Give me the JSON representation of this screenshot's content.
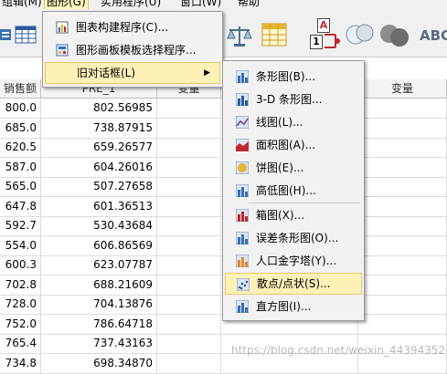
{
  "menubar": {
    "items": [
      {
        "label": "组辑(M)"
      },
      {
        "label": "图形(G)"
      },
      {
        "label": "实用程序(U)"
      },
      {
        "label": "窗口(W)"
      },
      {
        "label": "帮助"
      }
    ]
  },
  "toolbar": {
    "abc_label": "ABC",
    "a_label": "A",
    "one_label": "1"
  },
  "grid": {
    "headers": [
      "销售额",
      "PRE_1",
      "变量",
      "",
      "变量"
    ],
    "rows": [
      [
        "800.0",
        "802.56985"
      ],
      [
        "685.0",
        "738.87915"
      ],
      [
        "620.5",
        "659.26577"
      ],
      [
        "587.0",
        "604.26016"
      ],
      [
        "565.0",
        "507.27658"
      ],
      [
        "647.8",
        "601.36513"
      ],
      [
        "592.7",
        "530.43684"
      ],
      [
        "554.0",
        "606.86569"
      ],
      [
        "600.3",
        "623.07787"
      ],
      [
        "702.8",
        "688.21609"
      ],
      [
        "728.0",
        "704.13876"
      ],
      [
        "752.0",
        "786.64718"
      ],
      [
        "765.4",
        "737.43163"
      ],
      [
        "734.8",
        "698.34870"
      ]
    ]
  },
  "graph_menu": {
    "items": [
      {
        "label": "图表构建程序(C)...",
        "icon": "chart-builder-icon"
      },
      {
        "label": "图形画板模板选择程序...",
        "icon": "template-chooser-icon"
      },
      {
        "label": "旧对话框(L)",
        "icon": "",
        "submenu": true
      }
    ]
  },
  "legacy_menu": {
    "items": [
      {
        "label": "条形图(B)...",
        "icon": "bar-chart-icon"
      },
      {
        "label": "3-D 条形图...",
        "icon": "3d-bar-chart-icon"
      },
      {
        "label": "线图(L)...",
        "icon": "line-chart-icon"
      },
      {
        "label": "面积图(A)...",
        "icon": "area-chart-icon"
      },
      {
        "label": "饼图(E)...",
        "icon": "pie-chart-icon"
      },
      {
        "label": "高低图(H)...",
        "icon": "high-low-chart-icon"
      },
      {
        "label": "箱图(X)...",
        "icon": "boxplot-icon"
      },
      {
        "label": "误差条形图(O)...",
        "icon": "error-bar-icon"
      },
      {
        "label": "人口金字塔(Y)...",
        "icon": "pyramid-icon"
      },
      {
        "label": "散点/点状(S)...",
        "icon": "scatter-icon"
      },
      {
        "label": "直方图(I)...",
        "icon": "histogram-icon"
      }
    ]
  },
  "watermark": "https://blog.csdn.net/weixin_44394352"
}
